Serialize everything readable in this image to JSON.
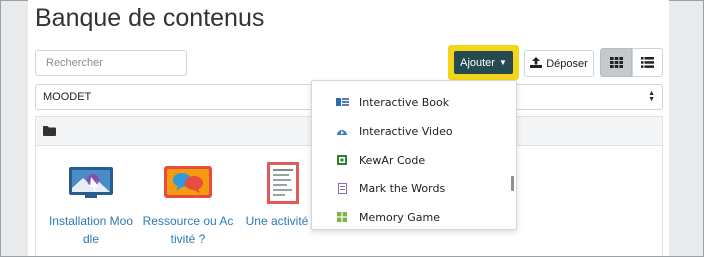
{
  "page": {
    "title": "Banque de contenus"
  },
  "search": {
    "placeholder": "Rechercher"
  },
  "toolbar": {
    "add_label": "Ajouter",
    "upload_label": "Déposer"
  },
  "context_select": {
    "value": "MOODET"
  },
  "files": [
    {
      "name": "Installation Moodle",
      "line1": "Installation Moo",
      "line2": "dle"
    },
    {
      "name": "Ressource ou Activité ?",
      "line1": "Ressource ou Ac",
      "line2": "tivité ?"
    },
    {
      "name": "Une activité H",
      "line1": "Une activité H",
      "line2": ""
    }
  ],
  "add_menu": {
    "items": [
      {
        "label": "Interactive Book",
        "icon": "book-icon"
      },
      {
        "label": "Interactive Video",
        "icon": "video-icon"
      },
      {
        "label": "KewAr Code",
        "icon": "qr-code-icon"
      },
      {
        "label": "Mark the Words",
        "icon": "mark-words-icon"
      },
      {
        "label": "Memory Game",
        "icon": "memory-game-icon"
      }
    ]
  },
  "colors": {
    "accent": "#264a52",
    "highlight": "#f3d51a",
    "link": "#2b7ab8"
  }
}
